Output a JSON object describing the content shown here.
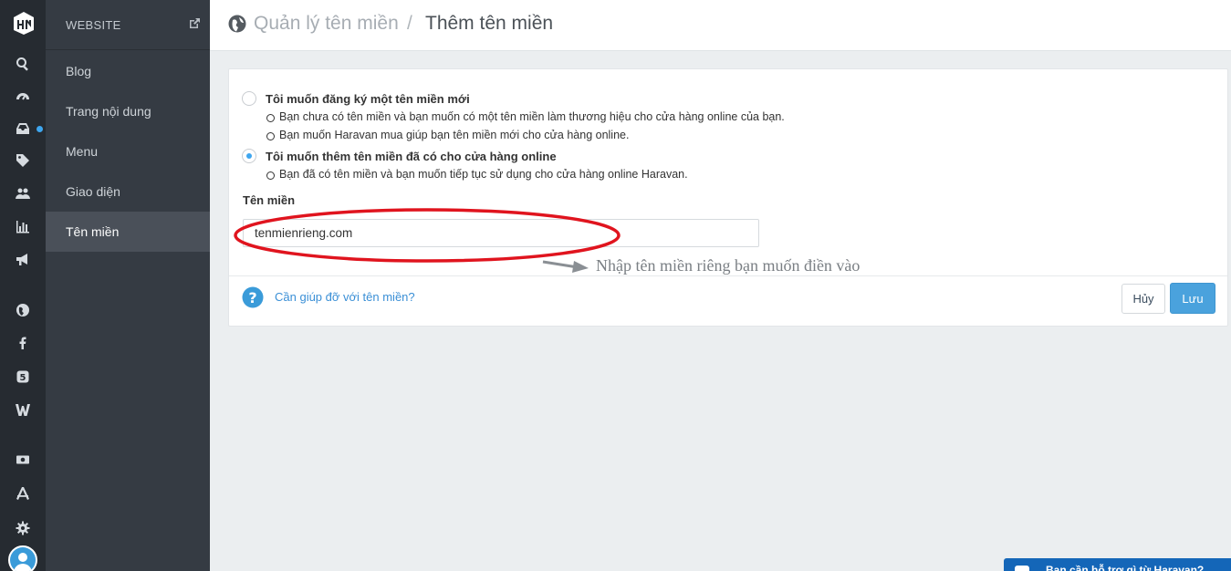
{
  "sidebar": {
    "section_title": "WEBSITE",
    "items": [
      {
        "label": "Blog",
        "active": false
      },
      {
        "label": "Trang nội dung",
        "active": false
      },
      {
        "label": "Menu",
        "active": false
      },
      {
        "label": "Giao diện",
        "active": false
      },
      {
        "label": "Tên miền",
        "active": true
      }
    ]
  },
  "rail": {
    "icons": [
      "search-icon",
      "dashboard-icon",
      "inbox-icon",
      "tag-icon",
      "users-icon",
      "bar-chart-icon",
      "megaphone-icon",
      "globe-icon",
      "facebook-icon",
      "s-icon",
      "w-icon",
      "money-icon",
      "app-store-icon",
      "gear-icon",
      "avatar"
    ]
  },
  "header": {
    "breadcrumb_parent": "Quản lý tên miền",
    "separator": "/",
    "breadcrumb_current": "Thêm tên miền"
  },
  "form": {
    "option_new": {
      "title": "Tôi muốn đăng ký một tên miền mới",
      "bullets": [
        "Bạn chưa có tên miền và bạn muốn có một tên miền làm thương hiệu cho cửa hàng online của bạn.",
        "Bạn muốn Haravan mua giúp bạn tên miền mới cho cửa hàng online."
      ],
      "selected": false
    },
    "option_existing": {
      "title": "Tôi muốn thêm tên miền đã có cho cửa hàng online",
      "bullets": [
        "Bạn đã có tên miền và bạn muốn tiếp tục sử dụng cho cửa hàng online Haravan."
      ],
      "selected": true
    },
    "domain_label": "Tên miền",
    "domain_value": "tenmienrieng.com",
    "annotation_note": "Nhập tên miền riêng bạn muốn điền vào"
  },
  "footer": {
    "help_link": "Cần giúp đỡ với tên miền?",
    "cancel_label": "Hủy",
    "save_label": "Lưu"
  },
  "chat_widget": {
    "label": "Bạn cần hỗ trợ gì từ Haravan?"
  },
  "colors": {
    "rail_bg": "#262b31",
    "sidebar_bg": "#353b43",
    "active_item_bg": "#4a5059",
    "accent": "#4aa2dd",
    "annotation_red": "#e0141e"
  }
}
